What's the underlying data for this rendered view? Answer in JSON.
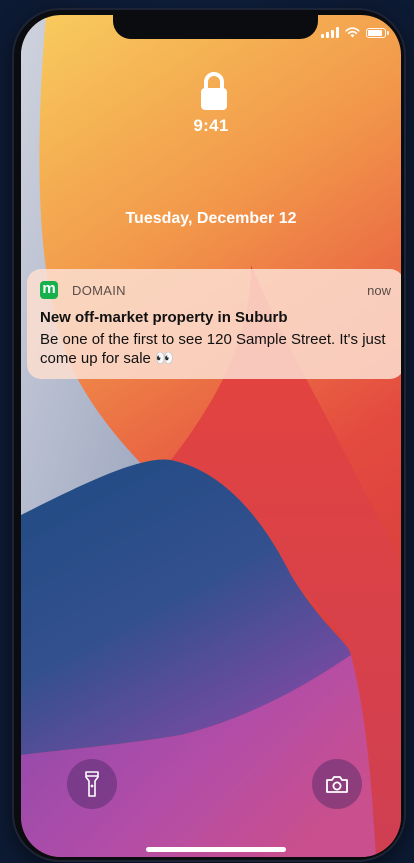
{
  "status_bar": {
    "icons": [
      "signal-icon",
      "wifi-icon",
      "battery-icon"
    ]
  },
  "lock_screen": {
    "lock_icon": "lock-icon",
    "time": "9:41",
    "date": "Tuesday, December 12"
  },
  "notification": {
    "app_icon": "m",
    "app_icon_color": "#16b04d",
    "app_name": "DOMAIN",
    "time": "now",
    "title": "New off-market property in Suburb",
    "body": "Be one of the first to see 120 Sample Street. It's just come up for sale 👀"
  },
  "quick_actions": {
    "left": "flashlight-icon",
    "right": "camera-icon"
  },
  "colors": {
    "wallpaper_yellow": "#f7c75a",
    "wallpaper_red": "#e2413e",
    "wallpaper_blue": "#24437a",
    "wallpaper_purple": "#b04cb0",
    "wallpaper_gray": "#b6bcd0"
  }
}
